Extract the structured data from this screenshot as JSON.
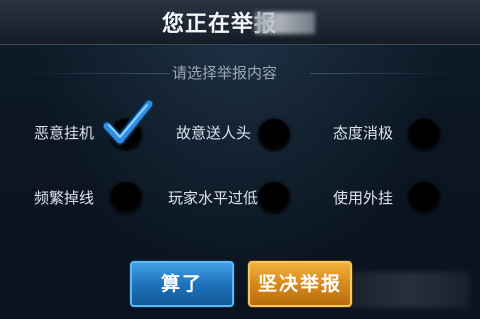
{
  "dialog": {
    "title": "您正在举报",
    "subtitle": "请选择举报内容"
  },
  "options": [
    {
      "label": "恶意挂机",
      "checked": true
    },
    {
      "label": "故意送人头",
      "checked": false
    },
    {
      "label": "态度消极",
      "checked": false
    },
    {
      "label": "频繁掉线",
      "checked": false
    },
    {
      "label": "玩家水平过低",
      "checked": false
    },
    {
      "label": "使用外挂",
      "checked": false
    }
  ],
  "buttons": {
    "cancel_label": "算了",
    "report_label": "坚决举报"
  },
  "colors": {
    "check_accent": "#2f8de4",
    "cancel_button": "#1c6fb8",
    "report_button": "#d3861a"
  }
}
